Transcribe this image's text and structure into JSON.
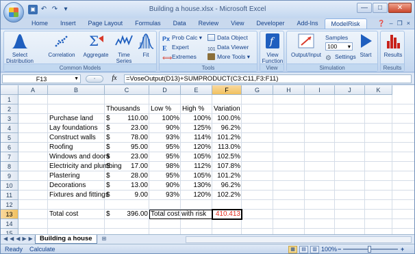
{
  "window": {
    "title": "Building a house.xlsx - Microsoft Excel",
    "controls": {
      "minimize": "—",
      "maximize": "□",
      "close": "✕"
    },
    "doc_controls": {
      "minimize": "–",
      "restore": "❐",
      "close": "×"
    }
  },
  "qat": {
    "undo": "↶",
    "redo": "↷"
  },
  "tabs": [
    "Home",
    "Insert",
    "Page Layout",
    "Formulas",
    "Data",
    "Review",
    "View",
    "Developer",
    "Add-Ins",
    "ModelRisk"
  ],
  "active_tab": "ModelRisk",
  "ribbon": {
    "groups": {
      "common_models": "Common Models",
      "tools": "Tools",
      "view": "View",
      "simulation": "Simulation",
      "results": "Results"
    },
    "buttons": {
      "select_distribution": "Select Distribution",
      "correlation": "Correlation",
      "aggregate": "Aggregate",
      "time_series": "Time Series",
      "fit": "Fit",
      "prob_calc": "Prob Calc",
      "expert": "Expert",
      "extremes": "Extremes",
      "data_object": "Data Object",
      "data_viewer": "Data Viewer",
      "more_tools": "More Tools",
      "view_function": "View Function",
      "output_input": "Output/Input",
      "samples_label": "Samples",
      "samples_value": "100",
      "settings": "Settings",
      "start": "Start",
      "results": "Results"
    },
    "colors": {
      "accent": "#0f5bc6",
      "results_red": "#c8221b"
    }
  },
  "formula_bar": {
    "name_box": "F13",
    "fx_label": "fx",
    "formula": "=VoseOutput(D13)+SUMPRODUCT(C3:C11,F3:F11)"
  },
  "sheet": {
    "columns": [
      "A",
      "B",
      "C",
      "D",
      "E",
      "F",
      "G",
      "H",
      "I",
      "J",
      "K"
    ],
    "selected_column": "F",
    "rows": [
      "1",
      "2",
      "3",
      "4",
      "5",
      "6",
      "7",
      "8",
      "9",
      "10",
      "11",
      "12",
      "13",
      "14",
      "15"
    ],
    "selected_row": "13",
    "headers": {
      "thousands": "Thousands",
      "low": "Low %",
      "high": "High %",
      "variation": "Variation"
    },
    "items": [
      {
        "task": "Purchase land",
        "cur": "$",
        "cost": "110.00",
        "low": "100%",
        "high": "100%",
        "variation": "100.0%"
      },
      {
        "task": "Lay foundations",
        "cur": "$",
        "cost": "23.00",
        "low": "90%",
        "high": "125%",
        "variation": "96.2%"
      },
      {
        "task": "Construct walls",
        "cur": "$",
        "cost": "78.00",
        "low": "93%",
        "high": "114%",
        "variation": "101.2%"
      },
      {
        "task": "Roofing",
        "cur": "$",
        "cost": "95.00",
        "low": "95%",
        "high": "120%",
        "variation": "113.0%"
      },
      {
        "task": "Windows and doors",
        "cur": "$",
        "cost": "23.00",
        "low": "95%",
        "high": "105%",
        "variation": "102.5%"
      },
      {
        "task": "Electricity and plumbing",
        "cur": "$",
        "cost": "17.00",
        "low": "98%",
        "high": "112%",
        "variation": "107.8%"
      },
      {
        "task": "Plastering",
        "cur": "$",
        "cost": "28.00",
        "low": "95%",
        "high": "105%",
        "variation": "101.2%"
      },
      {
        "task": "Decorations",
        "cur": "$",
        "cost": "13.00",
        "low": "90%",
        "high": "130%",
        "variation": "96.2%"
      },
      {
        "task": "Fixtures and fittings",
        "cur": "$",
        "cost": "9.00",
        "low": "93%",
        "high": "120%",
        "variation": "102.2%"
      }
    ],
    "total_label": "Total cost",
    "total_cur": "$",
    "total_value": "396.00",
    "risk_label": "Total cost with risk",
    "risk_value": "410.413",
    "sheet_tab": "Building a house"
  },
  "status": {
    "ready": "Ready",
    "calculate": "Calculate",
    "zoom": "100%",
    "zoom_out": "−",
    "zoom_in": "+"
  }
}
